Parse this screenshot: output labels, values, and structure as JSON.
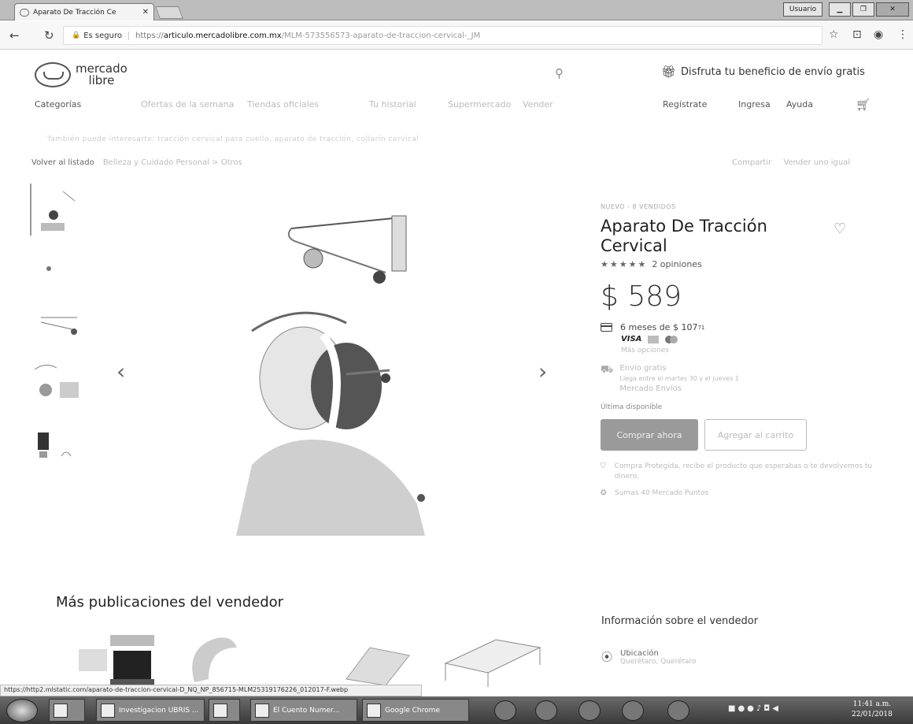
{
  "browser": {
    "tab_title": "Aparato De Tracción Ce",
    "tab_close": "✕",
    "secure_label": "Es seguro",
    "url_scheme": "https://",
    "url_host": "articulo.mercadolibre.com.mx",
    "url_path": "/MLM-573556573-aparato-de-traccion-cervical-_JM",
    "window_user": "Usuario"
  },
  "header": {
    "logo_top": "mercado",
    "logo_bottom": "libre",
    "search_placeholder": "",
    "free_shipping": "Disfruta tu beneficio de envío gratis"
  },
  "nav": {
    "categories": "Categorías",
    "offers": "Ofertas de la semana",
    "official_stores": "Tiendas oficiales",
    "history": "Tu historial",
    "supermarket": "Supermercado",
    "sell": "Vender",
    "register": "Regístrate",
    "login": "Ingresa",
    "help": "Ayuda"
  },
  "promo_line": "También puede interesarte: tracción cervical para cuello, aparato de tracción, collarín cervical",
  "breadcrumb": {
    "back": "Volver al listado",
    "path": "Belleza y Cuidado Personal  >  Otros"
  },
  "top_actions": {
    "share": "Compartir",
    "sell_one": "Vender uno igual"
  },
  "product": {
    "condition": "NUEVO - 8 VENDIDOS",
    "title": "Aparato De Tracción Cervical",
    "stars": "★★★★★",
    "reviews": "2 opiniones",
    "price": "$ 589",
    "installments": "6 meses de $ 107",
    "installments_sup": "71",
    "visa": "VISA",
    "more_options": "Más opciones",
    "shipping_title": "Envío gratis",
    "shipping_detail": "Llega entre el martes 30 y el jueves 1",
    "shipping_method": "Mercado Envíos",
    "quantity": "Última disponible",
    "buy_button": "Comprar ahora",
    "cart_button": "Agregar al carrito",
    "protection": "Compra Protegida, recibe el producto que esperabas o te devolvemos tu dinero.",
    "points": "Sumas 40 Mercado Puntos"
  },
  "seller": {
    "more_pubs": "Más publicaciones del vendedor",
    "info_title": "Información sobre el vendedor",
    "location_label": "Ubicación",
    "location_value": "Querétaro, Querétaro"
  },
  "status_link": "https://http2.mlstatic.com/aparato-de-traccion-cervical-D_NQ_NP_856715-MLM25319176226_012017-F.webp",
  "taskbar": {
    "btn1": "Investigacion UBRIS ...",
    "btn2": "El Cuento Numer...",
    "btn3": "Google Chrome",
    "clock_time": "11:41 a.m.",
    "clock_date": "22/01/2018"
  },
  "colors": {
    "accent_button": "#9a9a9a",
    "text_dark": "#222222"
  }
}
